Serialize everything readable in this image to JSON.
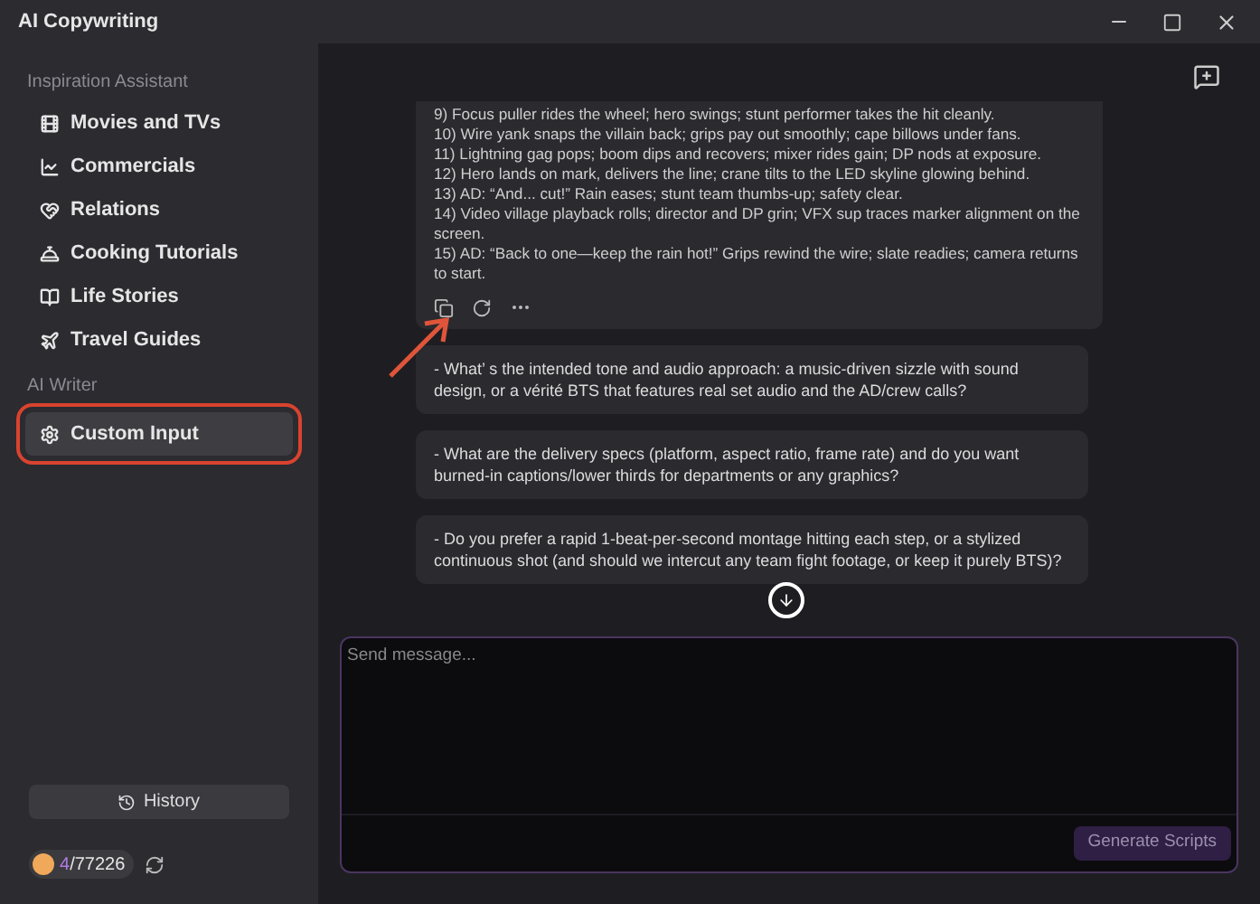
{
  "window": {
    "title": "AI Copywriting"
  },
  "sidebar": {
    "sections": [
      {
        "heading": "Inspiration Assistant",
        "items": [
          {
            "label": "Movies and TVs",
            "selected": false
          },
          {
            "label": "Commercials",
            "selected": false
          },
          {
            "label": "Relations",
            "selected": false
          },
          {
            "label": "Cooking Tutorials",
            "selected": false
          },
          {
            "label": "Life Stories",
            "selected": false
          },
          {
            "label": "Travel Guides",
            "selected": false
          }
        ]
      },
      {
        "heading": "AI Writer",
        "items": [
          {
            "label": "Custom Input",
            "selected": true
          }
        ]
      }
    ],
    "history_button": "History",
    "credits": {
      "used": "4",
      "total": "/77226"
    }
  },
  "chat": {
    "reply_lines": [
      "9) Focus puller rides the wheel; hero swings; stunt performer takes the hit cleanly.",
      "10) Wire yank snaps the villain back; grips pay out smoothly; cape billows under fans.",
      "11) Lightning gag pops; boom dips and recovers; mixer rides gain; DP nods at exposure.",
      "12) Hero lands on mark, delivers the line; crane tilts to the LED skyline glowing behind.",
      "13) AD: “And... cut!”  Rain eases; stunt team thumbs-up; safety clear.",
      "14) Video village playback rolls; director and DP grin; VFX sup traces marker alignment on the screen.",
      "15) AD: “Back to one—keep the rain hot!”  Grips rewind the wire; slate readies; camera returns to start."
    ],
    "questions": [
      "- What’ s the intended tone and audio approach: a music-driven sizzle with sound design, or a vérité BTS that features real set audio and the AD/crew calls?",
      "- What are the delivery specs (platform, aspect ratio, frame rate) and do you want burned-in captions/lower thirds for departments or any graphics?",
      "- Do you prefer a rapid 1-beat-per-second montage hitting each step, or a stylized continuous shot (and should we intercut any team fight footage, or keep it purely BTS)?"
    ]
  },
  "composer": {
    "placeholder": "Send message...",
    "button": "Generate Scripts"
  }
}
